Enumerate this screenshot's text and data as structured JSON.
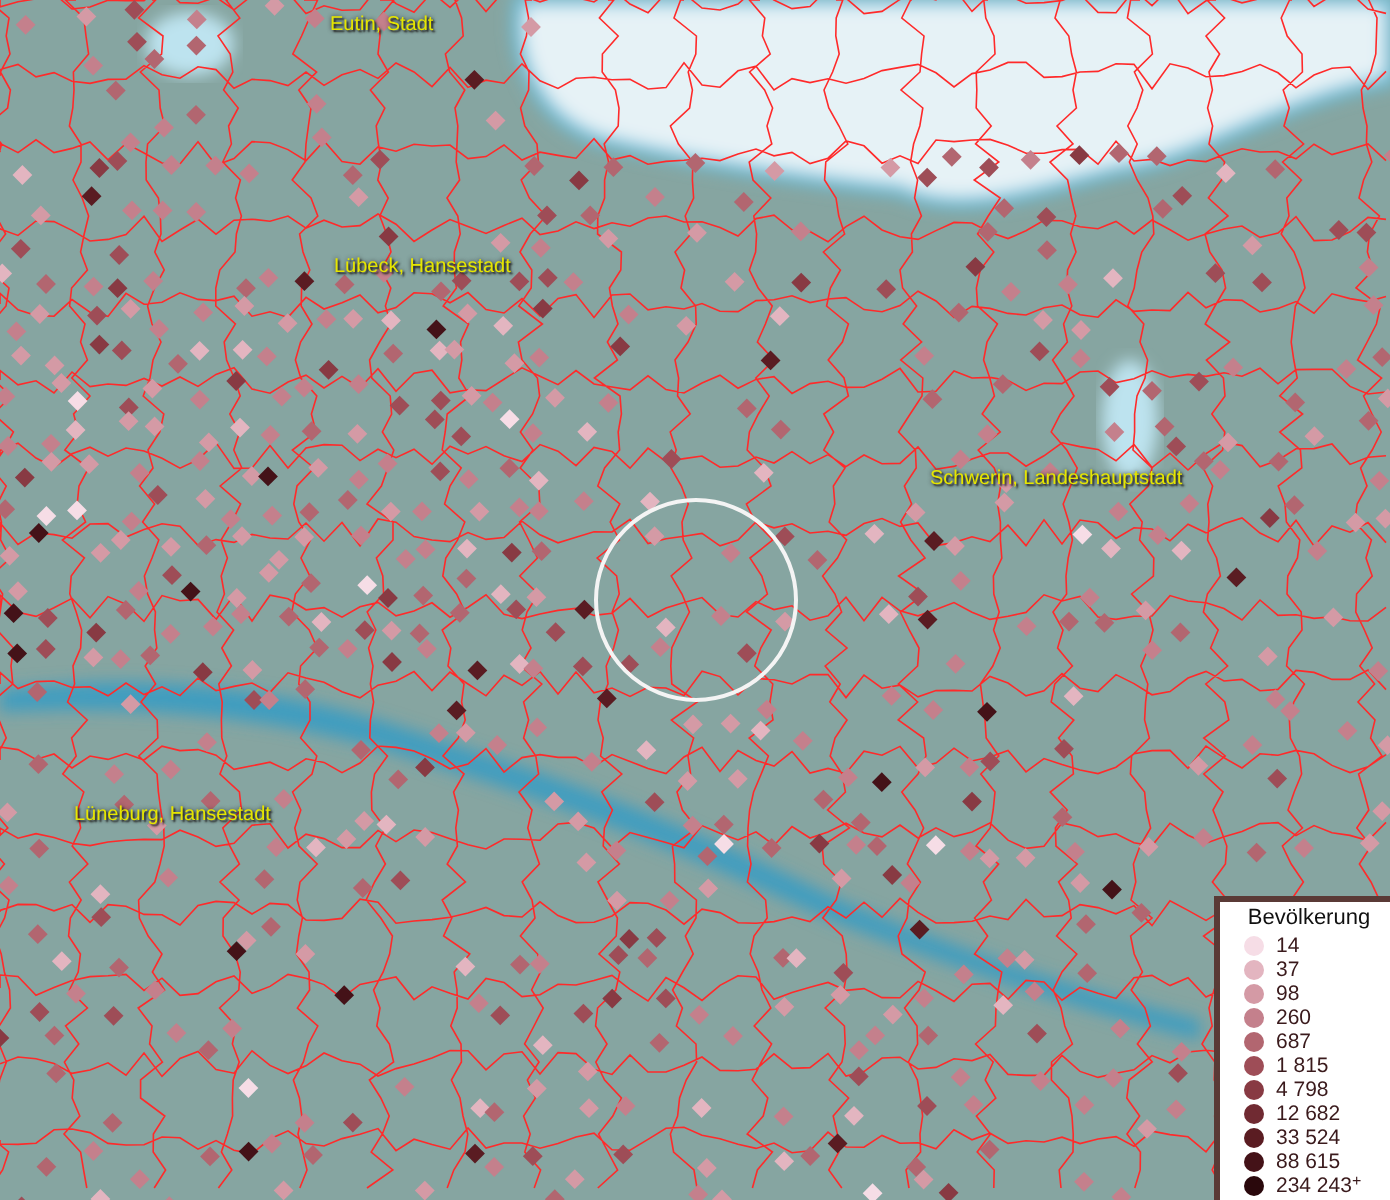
{
  "map": {
    "place_labels": [
      "Eutin, Stadt",
      "Lübeck, Hansestadt",
      "Schwerin, Landeshauptstadt",
      "Lüneburg, Hansestadt"
    ]
  },
  "legend": {
    "title": "Bevölkerung",
    "items": [
      {
        "label": "14",
        "color": "#f6dde6"
      },
      {
        "label": "37",
        "color": "#e3b5c0"
      },
      {
        "label": "98",
        "color": "#d49aa5"
      },
      {
        "label": "260",
        "color": "#c4808c"
      },
      {
        "label": "687",
        "color": "#b26670"
      },
      {
        "label": "1 815",
        "color": "#9e4d57"
      },
      {
        "label": "4 798",
        "color": "#883a43"
      },
      {
        "label": "12 682",
        "color": "#702a32"
      },
      {
        "label": "33 524",
        "color": "#5a1c22"
      },
      {
        "label": "88 615",
        "color": "#441218"
      },
      {
        "label": "234 243$^{+}$",
        "color": "#2a080c"
      }
    ]
  }
}
